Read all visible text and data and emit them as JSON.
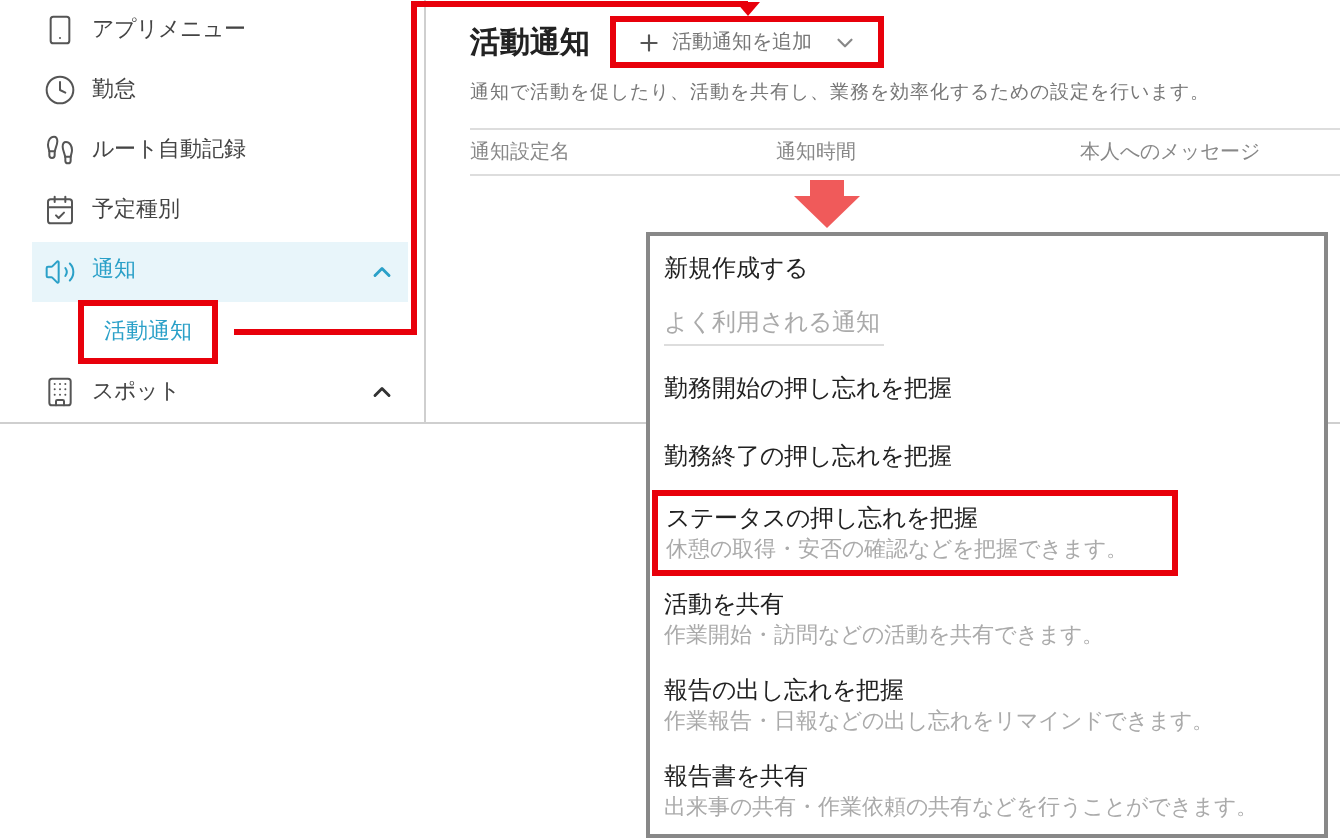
{
  "sidebar": {
    "items": [
      {
        "label": "アプリメニュー",
        "kind": "phone",
        "selected": false
      },
      {
        "label": "勤怠",
        "kind": "clock",
        "selected": false
      },
      {
        "label": "ルート自動記録",
        "kind": "footprints",
        "selected": false
      },
      {
        "label": "予定種別",
        "kind": "calendar",
        "selected": false
      },
      {
        "label": "通知",
        "kind": "speaker",
        "selected": true,
        "expanded": true,
        "children": [
          {
            "label": "活動通知",
            "selected": true,
            "highlighted": true
          }
        ]
      },
      {
        "label": "スポット",
        "kind": "building",
        "selected": false,
        "expanded": true
      }
    ]
  },
  "main": {
    "title": "活動通知",
    "add_button": {
      "label": "活動通知を追加",
      "highlighted": true
    },
    "description": "通知で活動を促したり、活動を共有し、業務を効率化するための設定を行います。",
    "table": {
      "columns": [
        "通知設定名",
        "通知時間",
        "本人へのメッセージ"
      ]
    }
  },
  "dropdown": {
    "items": [
      {
        "kind": "action",
        "title": "新規作成する"
      },
      {
        "kind": "section",
        "title": "よく利用される通知"
      },
      {
        "kind": "option",
        "title": "勤務開始の押し忘れを把握",
        "highlighted": false
      },
      {
        "kind": "option",
        "title": "勤務終了の押し忘れを把握",
        "highlighted": false
      },
      {
        "kind": "option",
        "title": "ステータスの押し忘れを把握",
        "description": "休憩の取得・安否の確認などを把握できます。",
        "highlighted": true
      },
      {
        "kind": "option",
        "title": "活動を共有",
        "description": "作業開始・訪問などの活動を共有できます。",
        "highlighted": false
      },
      {
        "kind": "option",
        "title": "報告の出し忘れを把握",
        "description": "作業報告・日報などの出し忘れをリマインドできます。",
        "highlighted": false
      },
      {
        "kind": "option",
        "title": "報告書を共有",
        "description": "出来事の共有・作業依頼の共有などを行うことができます。",
        "highlighted": false
      }
    ]
  }
}
